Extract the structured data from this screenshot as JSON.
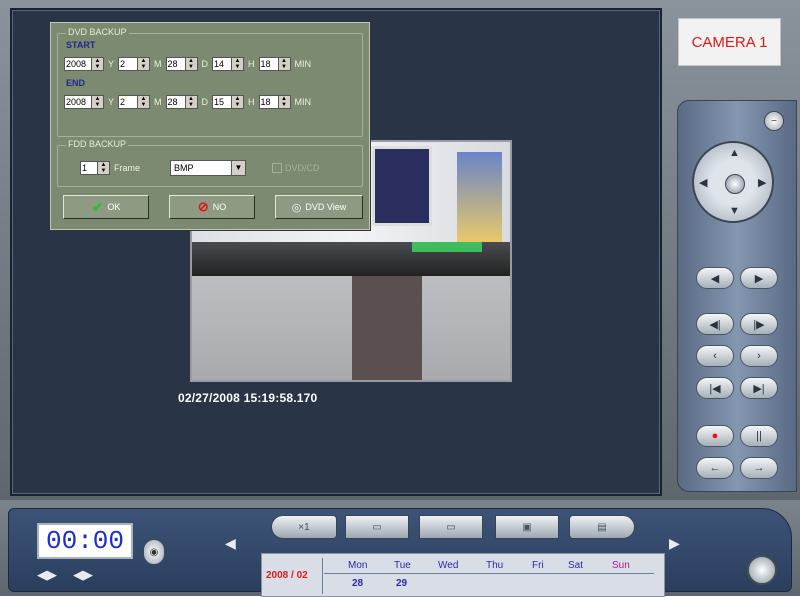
{
  "camera": {
    "label": "CAMERA 1"
  },
  "timestamp": "02/27/2008 15:19:58.170",
  "dvd_backup": {
    "title": "DVD BACKUP",
    "start_label": "START",
    "end_label": "END",
    "start": {
      "year": "2008",
      "month": "2",
      "day": "28",
      "hour": "14",
      "minute": "18"
    },
    "end": {
      "year": "2008",
      "month": "2",
      "day": "28",
      "hour": "15",
      "minute": "18"
    },
    "units": {
      "y": "Y",
      "m": "M",
      "d": "D",
      "h": "H",
      "min": "MIN"
    }
  },
  "fdd_backup": {
    "title": "FDD BACKUP",
    "frames": "1",
    "frame_label": "Frame",
    "format": "BMP",
    "option_label": "DVD/CD"
  },
  "buttons": {
    "ok": "OK",
    "no": "NO",
    "dvd_view": "DVD View"
  },
  "bottom": {
    "clock": "00:00",
    "speed": "×1",
    "calendar": {
      "month": "2008 / 02",
      "headers": [
        "Mon",
        "Tue",
        "Wed",
        "Thu",
        "Fri",
        "Sat",
        "Sun"
      ],
      "days": [
        "28",
        "29"
      ]
    }
  }
}
